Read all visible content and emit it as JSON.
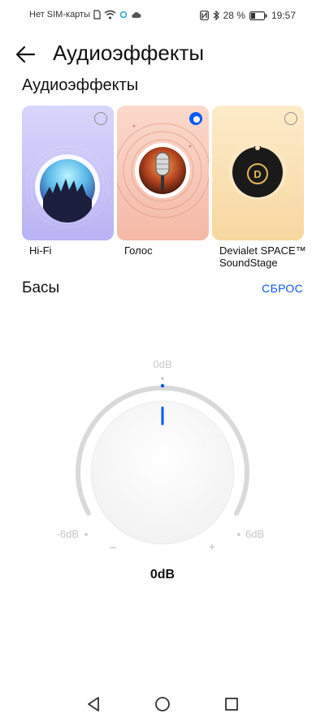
{
  "status_bar": {
    "carrier": "Нет SIM-карты",
    "battery_percent": "28 %",
    "time": "19:57"
  },
  "header": {
    "title": "Аудиоэффекты"
  },
  "effects_section": {
    "title": "Аудиоэффекты",
    "cards": [
      {
        "label": "Hi-Fi",
        "selected": false
      },
      {
        "label": "Голос",
        "selected": true
      },
      {
        "label": "Devialet SPACE™ SoundStage",
        "selected": false
      }
    ]
  },
  "bass": {
    "title": "Басы",
    "reset_label": "СБРОС",
    "scale_top": "0dB",
    "scale_min": "-6dB",
    "scale_max": "6dB",
    "minus_sign": "–",
    "plus_sign": "+",
    "current_value": "0dB"
  },
  "colors": {
    "accent": "#0a59f7"
  }
}
